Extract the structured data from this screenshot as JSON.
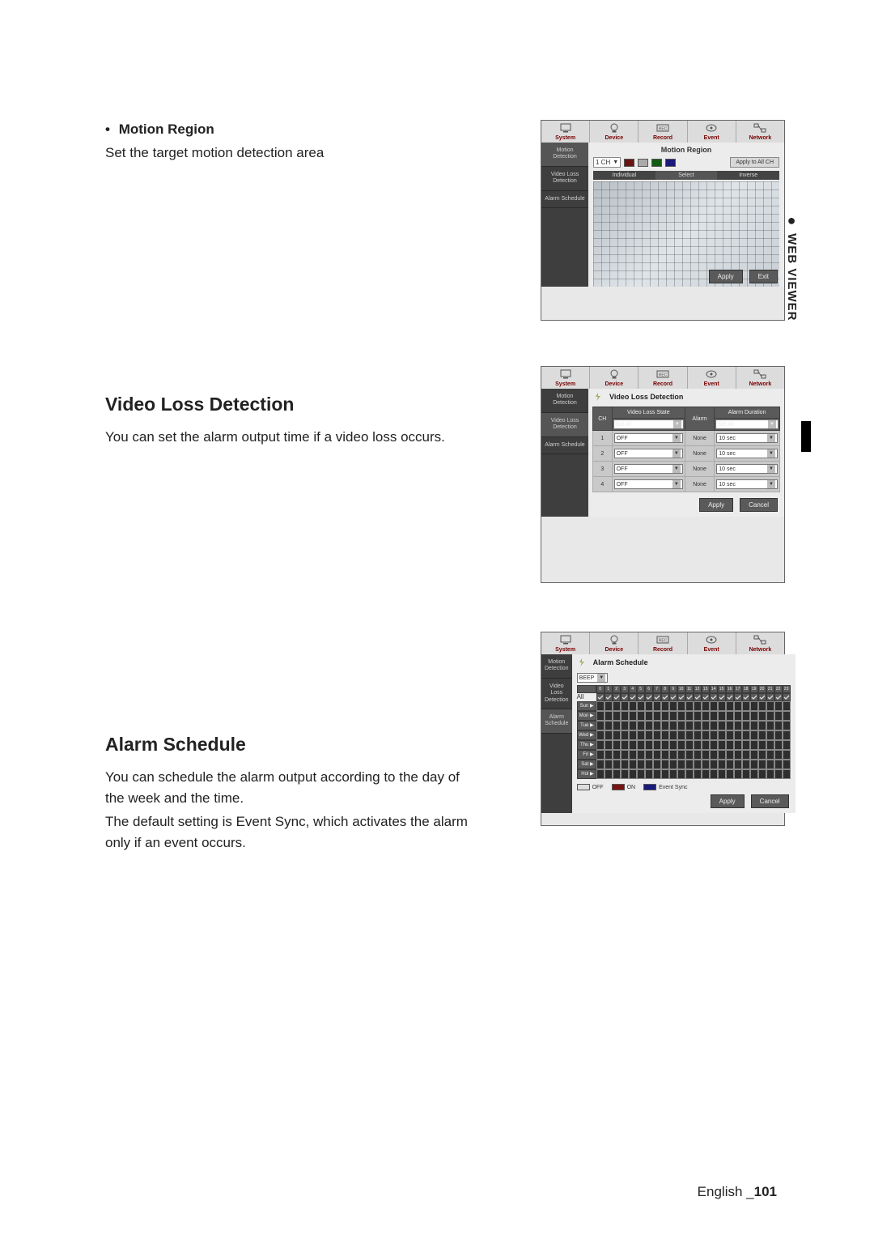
{
  "sideTab": {
    "dot": "●",
    "label": "WEB VIEWER"
  },
  "bullet": {
    "dot": "•",
    "label": "Motion Region",
    "desc": "Set the target motion detection area"
  },
  "sections": {
    "videoLoss": {
      "heading": "Video Loss Detection",
      "desc": "You can set the alarm output time if a video loss occurs."
    },
    "alarmSchedule": {
      "heading": "Alarm Schedule",
      "desc1": "You can schedule the alarm output according to the day of the week and the time.",
      "desc2": "The default setting is Event Sync, which activates the alarm only if an event occurs."
    }
  },
  "footer": {
    "lang": "English ",
    "pageLabel": "_",
    "page": "101"
  },
  "nav": [
    "System",
    "Device",
    "Record",
    "Event",
    "Network"
  ],
  "sidebarItems": [
    "Motion Detection",
    "Video Loss Detection",
    "Alarm Schedule"
  ],
  "shot1": {
    "title": "Motion Region",
    "channelSel": "1 CH",
    "applyAll": "Apply to All CH",
    "tabs": [
      "Individual",
      "Select",
      "Inverse"
    ],
    "apply": "Apply",
    "exit": "Exit"
  },
  "shot2": {
    "title": "Video Loss Detection",
    "headers": {
      "ch": "CH",
      "state": "Video Loss State",
      "alarm": "Alarm",
      "dur": "Alarm Duration"
    },
    "setAll": "Set All",
    "rows": [
      {
        "ch": "1",
        "state": "OFF",
        "alarm": "None",
        "dur": "10 sec"
      },
      {
        "ch": "2",
        "state": "OFF",
        "alarm": "None",
        "dur": "10 sec"
      },
      {
        "ch": "3",
        "state": "OFF",
        "alarm": "None",
        "dur": "10 sec"
      },
      {
        "ch": "4",
        "state": "OFF",
        "alarm": "None",
        "dur": "10 sec"
      }
    ],
    "apply": "Apply",
    "cancel": "Cancel"
  },
  "shot3": {
    "title": "Alarm Schedule",
    "sel": "BEEP",
    "hours": [
      "0",
      "1",
      "2",
      "3",
      "4",
      "5",
      "6",
      "7",
      "8",
      "9",
      "10",
      "11",
      "12",
      "13",
      "14",
      "15",
      "16",
      "17",
      "18",
      "19",
      "20",
      "21",
      "22",
      "23"
    ],
    "allLabel": "All",
    "days": [
      "Sun",
      "Mon",
      "Tue",
      "Wed",
      "Thu",
      "Fri",
      "Sat",
      "Hol"
    ],
    "legend": {
      "off": "OFF",
      "on": "ON",
      "ev": "Event Sync"
    },
    "apply": "Apply",
    "cancel": "Cancel"
  }
}
